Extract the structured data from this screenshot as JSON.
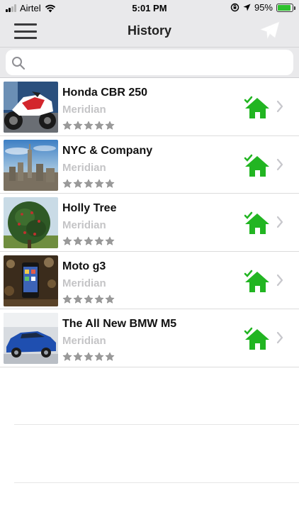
{
  "status": {
    "carrier": "Airtel",
    "time": "5:01 PM",
    "battery": "95%",
    "battery_level": 0.95
  },
  "nav": {
    "title": "History",
    "left_icon": "hamburger-menu-icon",
    "right_icon": "paper-plane-icon"
  },
  "search": {
    "placeholder": "",
    "value": ""
  },
  "colors": {
    "accent": "#22b522",
    "bar": "#e9e9eb",
    "subtitle": "#c4c4c6"
  },
  "items": [
    {
      "title": "Honda CBR 250",
      "subtitle": "Meridian",
      "rating": 0,
      "status_icon": "home-check-icon"
    },
    {
      "title": "NYC & Company",
      "subtitle": "Meridian",
      "rating": 0,
      "status_icon": "home-check-icon"
    },
    {
      "title": "Holly Tree",
      "subtitle": "Meridian",
      "rating": 0,
      "status_icon": "home-check-icon"
    },
    {
      "title": "Moto g3",
      "subtitle": "Meridian",
      "rating": 0,
      "status_icon": "home-check-icon"
    },
    {
      "title": "The All New BMW M5",
      "subtitle": "Meridian",
      "rating": 0,
      "status_icon": "home-check-icon"
    }
  ]
}
